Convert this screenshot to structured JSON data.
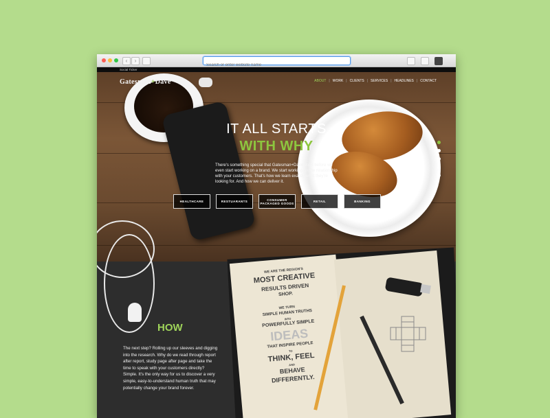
{
  "browser": {
    "address_placeholder": "Search or enter website name"
  },
  "ticker": {
    "label": "Social Ticker"
  },
  "header": {
    "logo_left": "Gatesman",
    "logo_plus": "+",
    "logo_right": "Dave",
    "nav": [
      "ABOUT",
      "WORK",
      "CLIENTS",
      "SERVICES",
      "HEADLINES",
      "CONTACT"
    ],
    "nav_active": "ABOUT"
  },
  "hero": {
    "title_line1": "IT ALL STARTS",
    "title_line2": "WITH WHY",
    "description": "There's something special that Gatesman+Dave does before we even start working on a brand. We start working on the relationship with your customers. That's how we learn exactly what they're looking for. And how we can deliver it.",
    "buttons": [
      "HEALTHCARE",
      "RESTUARANTS",
      "CONSUMER PACKAGED GOODS",
      "RETAIL",
      "BANKING"
    ]
  },
  "how": {
    "heading": "HOW",
    "paragraph": "The next step? Rolling up our sleeves and digging into the research. Why do we read through report after report, study page after page and take the time to speak with your customers directly? Simple. It's the only way for us to discover a very simple, easy-to-understand human truth that may potentially change your brand forever."
  },
  "notebook": {
    "line1": "WE ARE THE REGION'S",
    "line2": "MOST CREATIVE",
    "line3": "RESULTS DRIVEN",
    "line4": "SHOP.",
    "line5": "WE TURN",
    "line6": "SIMPLE HUMAN TRUTHS",
    "line7": "INTO",
    "line8": "POWERFULLY SIMPLE",
    "line9": "IDEAS",
    "line10": "THAT INSPIRE PEOPLE",
    "line11": "TO",
    "line12": "THINK, FEEL",
    "line13": "AND",
    "line14": "BEHAVE",
    "line15": "DIFFERENTLY."
  },
  "colors": {
    "accent": "#8dc63f",
    "background": "#b4dc8c"
  }
}
